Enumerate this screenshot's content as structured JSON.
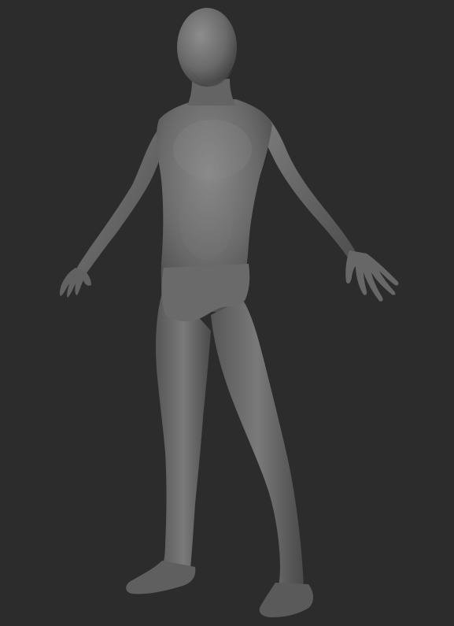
{
  "viewport": {
    "background_color": "#2c2c2c",
    "subject": "base-mesh-human-figure",
    "material_color": "#6e6e6e",
    "pose": "a-pose"
  }
}
